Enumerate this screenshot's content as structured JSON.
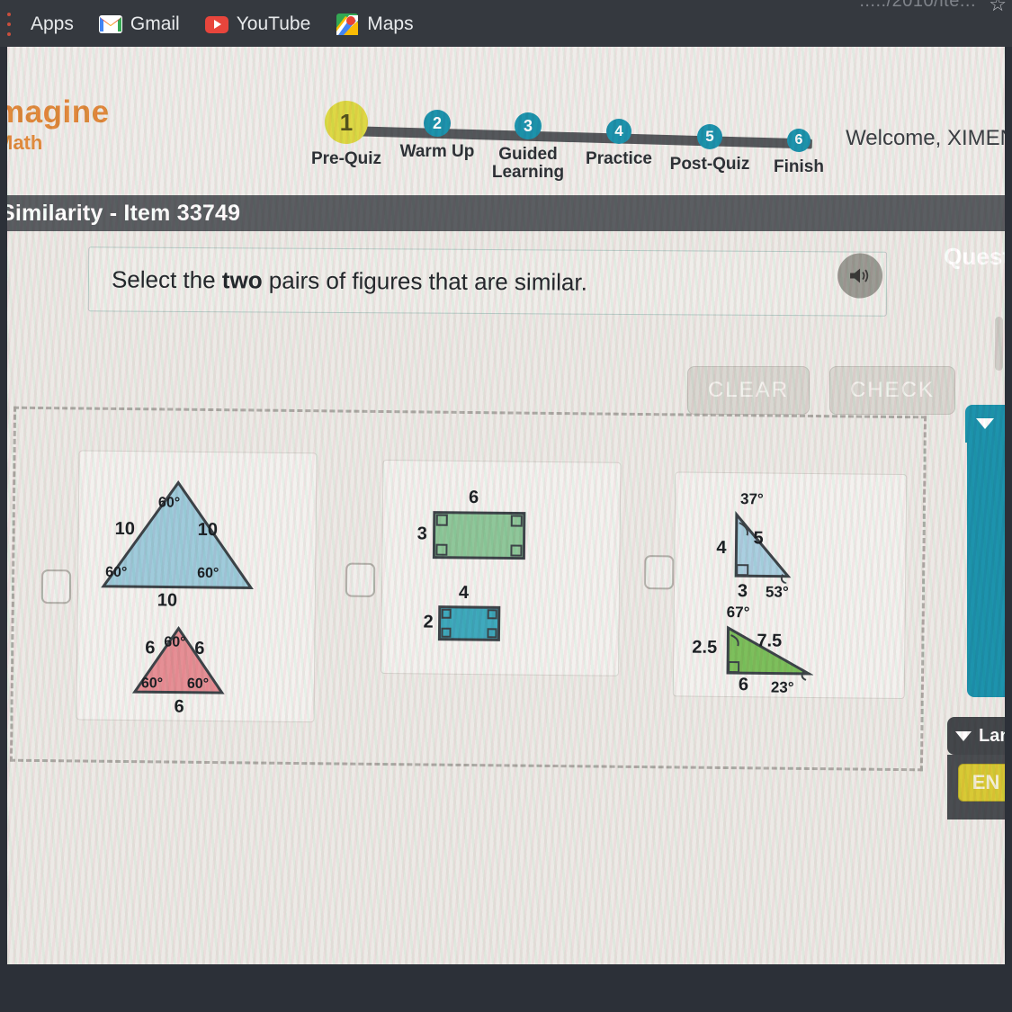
{
  "browser": {
    "url_fragment": "...../2010/ite...",
    "star_icon": "star-icon",
    "bookmarks": [
      {
        "label": "Apps",
        "icon": "apps-grid-icon"
      },
      {
        "label": "Gmail",
        "icon": "gmail-icon"
      },
      {
        "label": "YouTube",
        "icon": "youtube-icon"
      },
      {
        "label": "Maps",
        "icon": "maps-icon"
      }
    ]
  },
  "app": {
    "logo_line1": "magine",
    "logo_line2": "Math",
    "welcome": "Welcome, XIMENA",
    "item_title": "Similarity - Item 33749",
    "question_word": "Quest",
    "brand_color": "#e08a3c",
    "active_step_color": "#ddd845",
    "step_color": "#1d93ad"
  },
  "stepper": {
    "steps": [
      {
        "number": "1",
        "label": "Pre-Quiz",
        "active": true
      },
      {
        "number": "2",
        "label": "Warm Up",
        "active": false
      },
      {
        "number": "3",
        "label": "Guided\nLearning",
        "active": false
      },
      {
        "number": "4",
        "label": "Practice",
        "active": false
      },
      {
        "number": "5",
        "label": "Post-Quiz",
        "active": false
      },
      {
        "number": "6",
        "label": "Finish",
        "active": false
      }
    ]
  },
  "prompt": {
    "text_before": "Select the ",
    "text_bold": "two",
    "text_after": " pairs of figures that are similar.",
    "speaker_icon": "speaker-icon"
  },
  "actions": {
    "clear_label": "CLEAR",
    "check_label": "CHECK"
  },
  "figures": {
    "cards": [
      {
        "id": "card-triangles-equilateral",
        "checked": false,
        "shapes": [
          {
            "type": "equilateral-triangle",
            "fill": "#9fcbdb",
            "sides": [
              "10",
              "10",
              "10"
            ],
            "angles": [
              "60°",
              "60°",
              "60°"
            ]
          },
          {
            "type": "equilateral-triangle",
            "fill": "#e58f95",
            "sides": [
              "6",
              "6",
              "6"
            ],
            "angles": [
              "60°",
              "60°",
              "60°"
            ]
          }
        ]
      },
      {
        "id": "card-rectangles",
        "checked": false,
        "shapes": [
          {
            "type": "rectangle",
            "fill": "#8fc79a",
            "width_label": "6",
            "height_label": "3",
            "right_angle_marks": 4
          },
          {
            "type": "rectangle",
            "fill": "#3fa9bd",
            "width_label": "4",
            "height_label": "2",
            "right_angle_marks": 4
          }
        ]
      },
      {
        "id": "card-right-triangles",
        "checked": false,
        "shapes": [
          {
            "type": "right-triangle",
            "fill": "#aacfe0",
            "leg_vertical": "4",
            "hypotenuse": "5",
            "leg_base": "3",
            "angle_top": "37°",
            "angle_bottom_right": "53°"
          },
          {
            "type": "right-triangle",
            "fill": "#7dbf5c",
            "leg_vertical": "2.5",
            "hypotenuse": "7.5",
            "leg_base": "6",
            "angle_top": "67°",
            "angle_bottom_right": "23°"
          }
        ]
      }
    ]
  },
  "rail": {
    "teal_panel_icon": "chevron-down-icon",
    "language_label": "Lan",
    "language_caret_icon": "caret-down-icon",
    "language_value": "EN"
  }
}
